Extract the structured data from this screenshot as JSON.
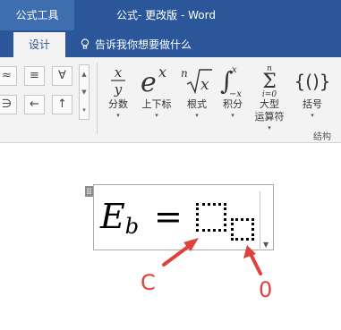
{
  "titlebar": {
    "context_tab": "公式工具",
    "doc_title": "公式- 更改版  -  Word"
  },
  "tabs": {
    "active": "设计",
    "tell_me": "告诉我你想要做什么"
  },
  "symbols": [
    "≈",
    "≡",
    "∀",
    "∋",
    "←",
    "↑"
  ],
  "tools": [
    {
      "label": "分数",
      "icon": "fraction-icon"
    },
    {
      "label": "上下标",
      "icon": "script-icon"
    },
    {
      "label": "根式",
      "icon": "radical-icon"
    },
    {
      "label": "积分",
      "icon": "integral-icon"
    },
    {
      "label": "大型",
      "label2": "运算符",
      "icon": "large-operator-icon"
    },
    {
      "label": "括号",
      "icon": "bracket-icon"
    }
  ],
  "group_label": "结构",
  "equation": {
    "base": "E",
    "sub": "b",
    "op": "="
  },
  "annotations": {
    "left": "C",
    "right": "0"
  },
  "colors": {
    "word_blue": "#2b579a",
    "annotation_red": "#e0413a"
  }
}
